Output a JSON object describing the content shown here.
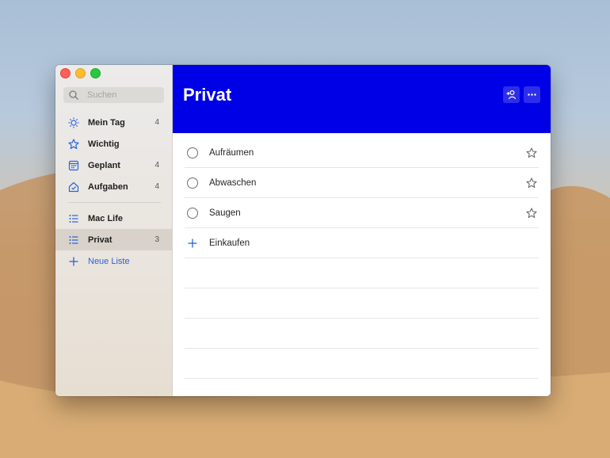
{
  "colors": {
    "accent_blue": "#0000e6",
    "link_blue": "#2b62d9",
    "sidebar_bg": "#ebe8e4",
    "selected_row": "#d8d2ca"
  },
  "window": {
    "traffic_lights": [
      "close",
      "minimize",
      "zoom"
    ]
  },
  "sidebar": {
    "search": {
      "placeholder": "Suchen",
      "value": "",
      "icon": "search-icon"
    },
    "smart_lists": [
      {
        "label": "Mein Tag",
        "count": "4",
        "icon": "sun-icon"
      },
      {
        "label": "Wichtig",
        "count": "",
        "icon": "star-icon"
      },
      {
        "label": "Geplant",
        "count": "4",
        "icon": "calendar-icon"
      },
      {
        "label": "Aufgaben",
        "count": "4",
        "icon": "home-icon"
      }
    ],
    "lists": [
      {
        "label": "Mac Life",
        "count": "",
        "icon": "list-icon",
        "selected": false
      },
      {
        "label": "Privat",
        "count": "3",
        "icon": "list-icon",
        "selected": true
      }
    ],
    "new_list": {
      "label": "Neue Liste",
      "icon": "plus-icon"
    }
  },
  "main": {
    "title": "Privat",
    "header_buttons": [
      "share-icon",
      "more-icon"
    ],
    "tasks": [
      {
        "title": "Aufräumen",
        "completed": false,
        "important": false
      },
      {
        "title": "Abwaschen",
        "completed": false,
        "important": false
      },
      {
        "title": "Saugen",
        "completed": false,
        "important": false
      }
    ],
    "add_task": {
      "label": "Einkaufen"
    }
  }
}
